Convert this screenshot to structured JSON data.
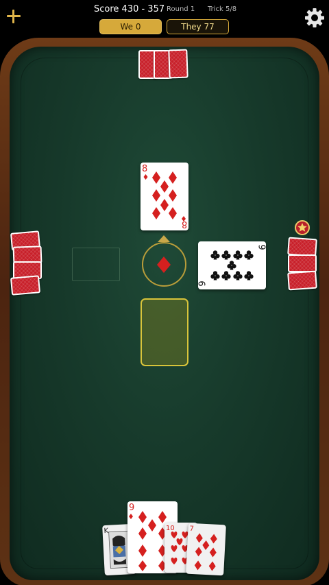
{
  "header": {
    "score_text": "Score 430 - 357",
    "round_text": "Round 1",
    "trick_text": "Trick 5/8",
    "we_label": "We 0",
    "they_label": "They 77"
  },
  "icons": {
    "add": "plus-icon",
    "settings": "gear-icon",
    "trump": "diamond-icon",
    "dealer": "star-icon"
  },
  "colors": {
    "accent_gold": "#d6a93a",
    "felt": "#173a2b",
    "rim": "#5a2e12",
    "card_back": "#c8202a",
    "red_suit": "#d5201f"
  },
  "table": {
    "trump_suit": "diamonds",
    "played": {
      "north": {
        "rank": "8",
        "suit": "diamonds"
      },
      "east": {
        "rank": "9",
        "suit": "clubs"
      }
    }
  },
  "hand": [
    {
      "rank": "K",
      "suit": "spades"
    },
    {
      "rank": "9",
      "suit": "diamonds"
    },
    {
      "rank": "10",
      "suit": "hearts"
    },
    {
      "rank": "7",
      "suit": "diamonds"
    }
  ]
}
